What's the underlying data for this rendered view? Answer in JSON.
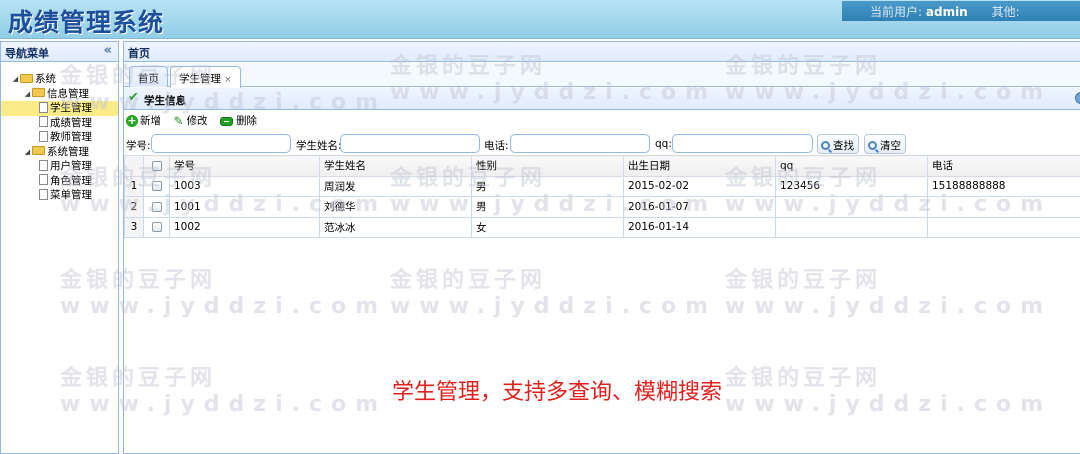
{
  "app": {
    "title": "成绩管理系统"
  },
  "userbar": {
    "current_user_label": "当前用户:",
    "current_user": "admin",
    "other_label": "其他:"
  },
  "sidebar": {
    "title": "导航菜单",
    "tree": [
      {
        "label": "系统",
        "type": "folder",
        "level": 0,
        "expanded": true
      },
      {
        "label": "信息管理",
        "type": "folder",
        "level": 1,
        "expanded": true
      },
      {
        "label": "学生管理",
        "type": "file",
        "level": 2,
        "selected": true
      },
      {
        "label": "成绩管理",
        "type": "file",
        "level": 2
      },
      {
        "label": "教师管理",
        "type": "file",
        "level": 2
      },
      {
        "label": "系统管理",
        "type": "folder",
        "level": 1,
        "expanded": true
      },
      {
        "label": "用户管理",
        "type": "file",
        "level": 2
      },
      {
        "label": "角色管理",
        "type": "file",
        "level": 2
      },
      {
        "label": "菜单管理",
        "type": "file",
        "level": 2
      }
    ]
  },
  "main": {
    "header": "首页",
    "tabs": [
      {
        "label": "首页",
        "active": false,
        "closable": false
      },
      {
        "label": "学生管理",
        "active": true,
        "closable": true,
        "close_glyph": "×"
      }
    ],
    "panel_title": "学生信息",
    "toolbar": {
      "add": "新增",
      "edit": "修改",
      "delete": "删除"
    },
    "search": {
      "id_label": "学号:",
      "name_label": "学生姓名:",
      "phone_label": "电话:",
      "qq_label": "qq:",
      "search_btn": "查找",
      "clear_btn": "清空"
    },
    "grid": {
      "columns": [
        "学号",
        "学生姓名",
        "性别",
        "出生日期",
        "qq",
        "电话"
      ],
      "rows": [
        {
          "no": "1",
          "cells": [
            "1003",
            "周润发",
            "男",
            "2015-02-02",
            "123456",
            "15188888888"
          ]
        },
        {
          "no": "2",
          "cells": [
            "1001",
            "刘德华",
            "男",
            "2016-01-07",
            "",
            ""
          ]
        },
        {
          "no": "3",
          "cells": [
            "1002",
            "范冰冰",
            "女",
            "2016-01-14",
            "",
            ""
          ]
        }
      ]
    }
  },
  "watermark": {
    "line1": "金银的豆子网",
    "line2": "www.jyddzi.com"
  },
  "caption": "学生管理，支持多查询、模糊搜索"
}
